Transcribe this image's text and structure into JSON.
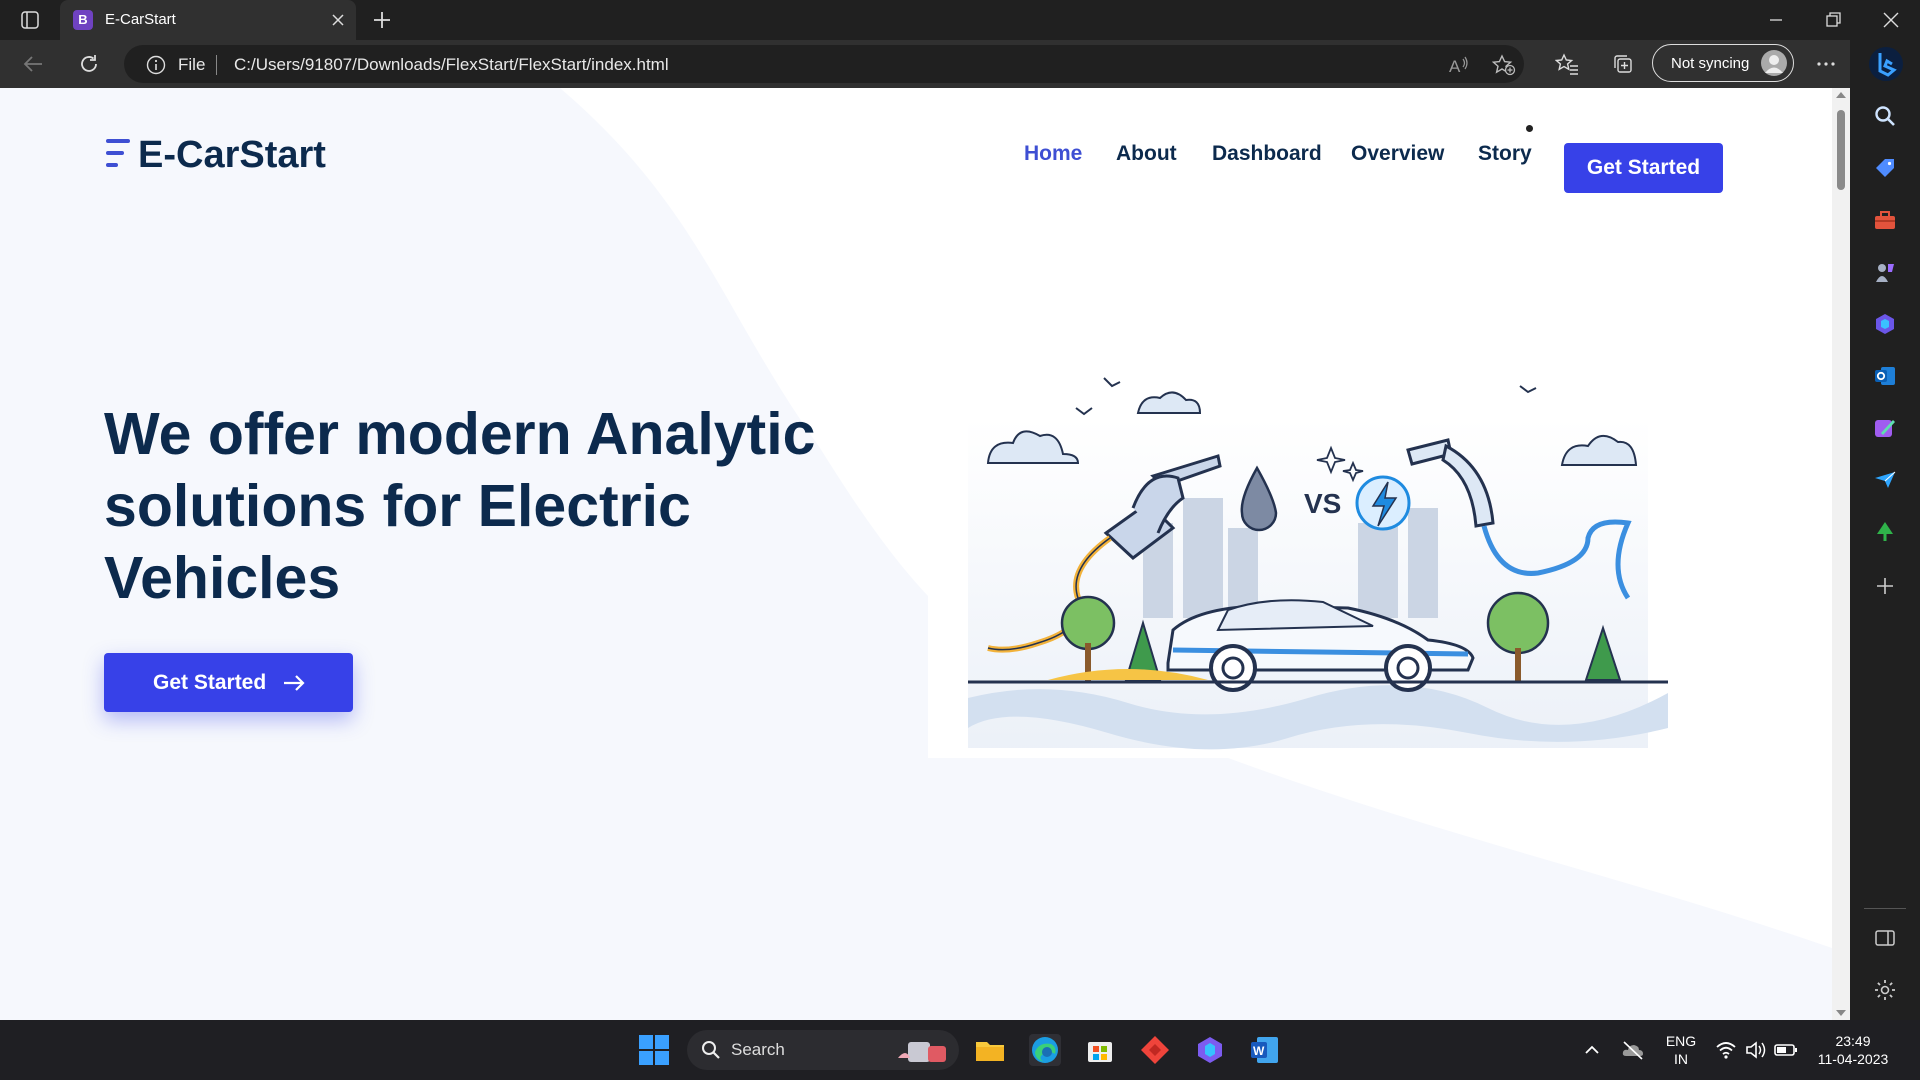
{
  "browser": {
    "tab_title": "E-CarStart",
    "tab_favicon": "B",
    "url_scheme_label": "File",
    "url": "C:/Users/91807/Downloads/FlexStart/FlexStart/index.html",
    "sync_label": "Not syncing"
  },
  "site": {
    "logo_text": "E-CarStart",
    "nav": [
      {
        "label": "Home",
        "active": true
      },
      {
        "label": "About",
        "active": false
      },
      {
        "label": "Dashboard",
        "active": false
      },
      {
        "label": "Overview",
        "active": false
      },
      {
        "label": "Story",
        "active": false
      }
    ],
    "nav_cta": "Get Started",
    "hero_title": "We offer modern Analytic solutions for Electric Vehicles",
    "hero_cta": "Get Started",
    "illustration_text": "VS",
    "colors": {
      "brand": "#3741e8",
      "heading": "#0c2a4d",
      "active_nav": "#3e4fd3"
    }
  },
  "taskbar": {
    "search_label": "Search",
    "lang_top": "ENG",
    "lang_bottom": "IN",
    "time": "23:49",
    "date": "11-04-2023"
  }
}
